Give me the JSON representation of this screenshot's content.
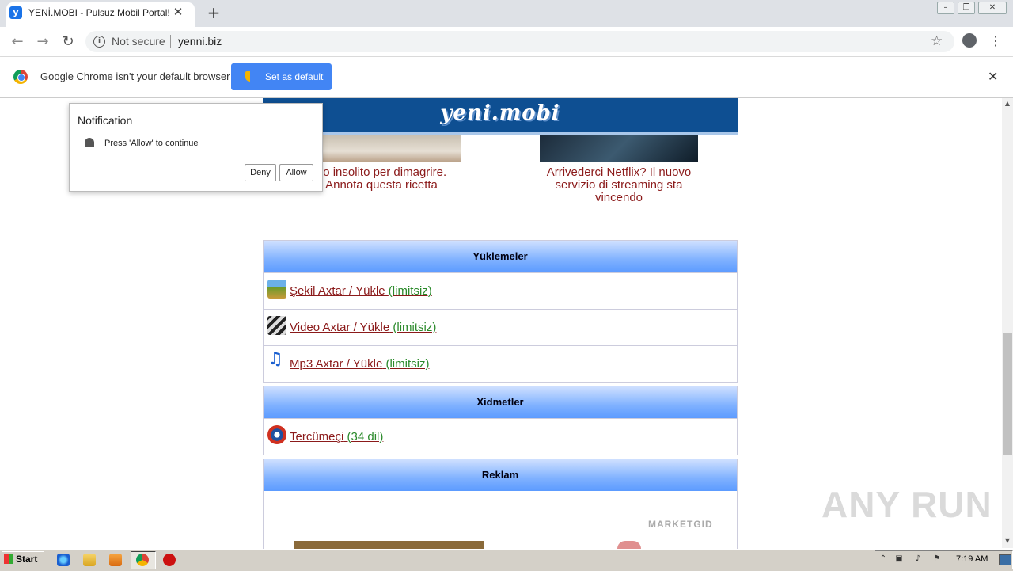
{
  "browser": {
    "tab_title": "YENİ.MOBI - Pulsuz Mobil Portal!",
    "tab_favicon_letter": "y",
    "security_label": "Not secure",
    "url": "yenni.biz"
  },
  "infobar": {
    "message": "Google Chrome isn't your default browser",
    "button_label": "Set as default"
  },
  "notification": {
    "title": "Notification",
    "message": "Press 'Allow' to continue",
    "deny_label": "Deny",
    "allow_label": "Allow"
  },
  "site": {
    "logo": "yeni.mobi",
    "articles": [
      "do insolito per dimagrire. Annota questa ricetta",
      "Arrivederci Netflix? Il nuovo servizio di streaming sta vincendo"
    ],
    "sections": [
      {
        "title": "Yüklemeler",
        "rows": [
          {
            "link": "Şekil Axtar / Yükle",
            "note": "(limitsiz)",
            "icon": "image-icon"
          },
          {
            "link": "Video Axtar / Yükle",
            "note": "(limitsiz)",
            "icon": "video-clapper-icon"
          },
          {
            "link": "Mp3 Axtar / Yükle",
            "note": "(limitsiz)",
            "icon": "music-note-icon"
          }
        ]
      },
      {
        "title": "Xidmetler",
        "rows": [
          {
            "link": "Tercümeçi",
            "note": "(34 dil)",
            "icon": "globe-icon"
          }
        ]
      },
      {
        "title": "Reklam",
        "rows": []
      }
    ],
    "ad_brand": "MARKETGID"
  },
  "watermark": "ANY RUN",
  "taskbar": {
    "start_label": "Start",
    "clock": "7:19 AM"
  },
  "colors": {
    "header_blue": "#0e4f92",
    "link_red": "#8b1a1a",
    "note_green": "#2b8a2b",
    "chrome_blue": "#4285f4"
  }
}
